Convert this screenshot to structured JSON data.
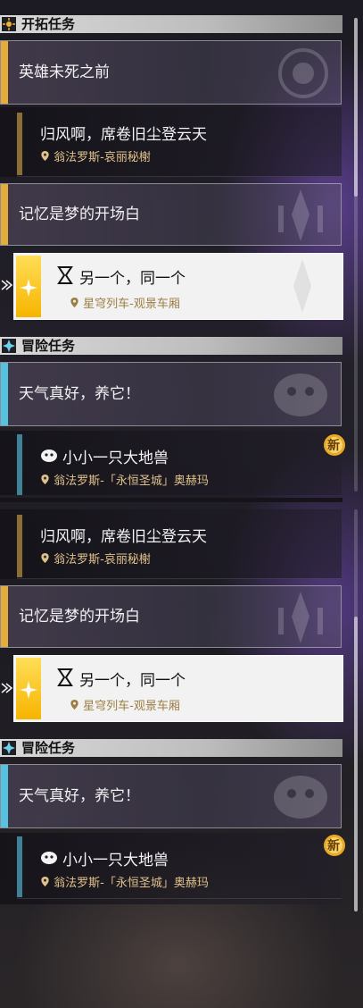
{
  "section_trailblaze": {
    "title": "开拓任务"
  },
  "section_adventure": {
    "title": "冒险任务"
  },
  "quests": {
    "heroes": {
      "title": "英雄未死之前"
    },
    "wind": {
      "title": "归风啊，席卷旧尘登云天",
      "location": "翁法罗斯-哀丽秘榭"
    },
    "memory": {
      "title": "记忆是梦的开场白"
    },
    "another": {
      "title": "另一个，同一个",
      "location": "星穹列车-观景车厢"
    },
    "weather": {
      "title": "天气真好，养它！"
    },
    "beast": {
      "title": "小小一只大地兽",
      "location": "翁法罗斯-「永恒圣城」奥赫玛"
    }
  },
  "badge_new": "新",
  "colors": {
    "trailblaze_accent": "#e3ac3b",
    "adventure_accent": "#55c3e0",
    "selected_gold": "#f6c12a",
    "location_text": "#e0c18a"
  }
}
